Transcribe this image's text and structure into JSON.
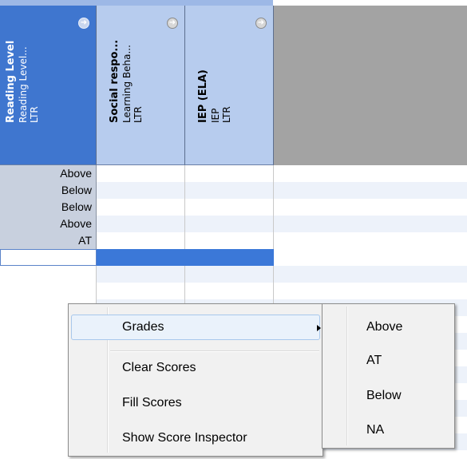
{
  "columns": [
    {
      "title": "Reading Level",
      "line2": "Reading Level...",
      "line3": "LTR",
      "selected": true
    },
    {
      "title": "Social respo...",
      "line2": "Learning Beha...",
      "line3": "LTR",
      "selected": false
    },
    {
      "title": "IEP (ELA)",
      "line2": "IEP",
      "line3": "LTR",
      "selected": false
    }
  ],
  "rows": [
    {
      "reading_level": "Above"
    },
    {
      "reading_level": "Below"
    },
    {
      "reading_level": "Below"
    },
    {
      "reading_level": "Above"
    },
    {
      "reading_level": "AT"
    }
  ],
  "edit_row": {
    "reading_level": ""
  },
  "context_menu": {
    "items": [
      {
        "label": "Grades",
        "has_submenu": true
      },
      {
        "label": "Clear Scores"
      },
      {
        "label": "Fill Scores"
      },
      {
        "label": "Show Score Inspector"
      }
    ]
  },
  "submenu": {
    "items": [
      {
        "label": "Above"
      },
      {
        "label": "AT"
      },
      {
        "label": "Below"
      },
      {
        "label": "NA"
      }
    ]
  },
  "colors": {
    "selected_header": "#3f76cf",
    "header": "#b7ccee",
    "selection": "#3b78d8",
    "row_alt": "#edf2fa"
  },
  "icons": {
    "column_header": "arrow-right-circle-icon",
    "submenu": "chevron-right-icon"
  }
}
